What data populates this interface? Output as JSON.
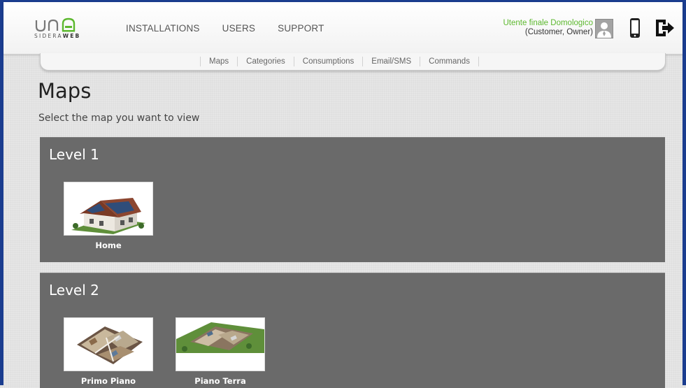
{
  "header": {
    "logo_brand_light": "SIDERA",
    "logo_brand_bold": "WEB",
    "nav": [
      "INSTALLATIONS",
      "USERS",
      "SUPPORT"
    ],
    "user_name": "Utente finale Domologico",
    "user_role": "(Customer, Owner)"
  },
  "subnav": [
    "Maps",
    "Categories",
    "Consumptions",
    "Email/SMS",
    "Commands"
  ],
  "page": {
    "title": "Maps",
    "subtitle": "Select the map you want to view"
  },
  "levels": [
    {
      "title": "Level 1",
      "maps": [
        {
          "label": "Home"
        }
      ]
    },
    {
      "title": "Level 2",
      "maps": [
        {
          "label": "Primo Piano"
        },
        {
          "label": "Piano Terra"
        }
      ]
    }
  ],
  "colors": {
    "accent_green": "#5cb82e",
    "panel_gray": "#6a6a6a",
    "frame_blue": "#1b3d8f"
  },
  "icons": {
    "avatar": "user-avatar-icon",
    "device": "mobile-phone-icon",
    "logout": "logout-icon"
  }
}
